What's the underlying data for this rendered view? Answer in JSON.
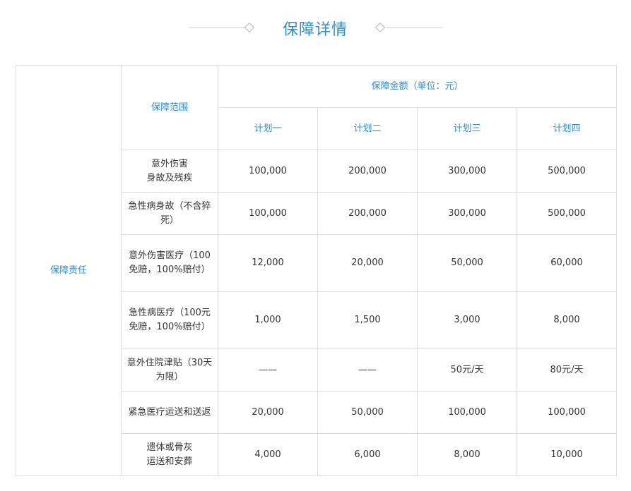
{
  "page_title": "保障详情",
  "table": {
    "responsibility_label": "保障责任",
    "scope_header": "保障范围",
    "amount_header": "保障金额（单位：元）",
    "plans": [
      "计划一",
      "计划二",
      "计划三",
      "计划四"
    ],
    "rows": [
      {
        "name_lines": [
          "意外伤害",
          "身故及残疾"
        ],
        "values": [
          "100,000",
          "200,000",
          "300,000",
          "500,000"
        ]
      },
      {
        "name_lines": [
          "急性病身故（不含猝",
          "死）"
        ],
        "values": [
          "100,000",
          "200,000",
          "300,000",
          "500,000"
        ]
      },
      {
        "name_lines": [
          "意外伤害医疗（100",
          "免赔，100%赔付）"
        ],
        "values": [
          "12,000",
          "20,000",
          "50,000",
          "60,000"
        ]
      },
      {
        "name_lines": [
          "急性病医疗（100元",
          "免赔，100%赔付）"
        ],
        "values": [
          "1,000",
          "1,500",
          "3,000",
          "8,000"
        ]
      },
      {
        "name_lines": [
          "意外住院津贴（30天",
          "为限）"
        ],
        "values": [
          "——",
          "——",
          "50元/天",
          "80元/天"
        ]
      },
      {
        "name_lines": [
          "紧急医疗运送和送返"
        ],
        "values": [
          "20,000",
          "50,000",
          "100,000",
          "100,000"
        ]
      },
      {
        "name_lines": [
          "遗体或骨灰",
          "运送和安葬"
        ],
        "values": [
          "4,000",
          "6,000",
          "8,000",
          "10,000"
        ]
      }
    ]
  }
}
